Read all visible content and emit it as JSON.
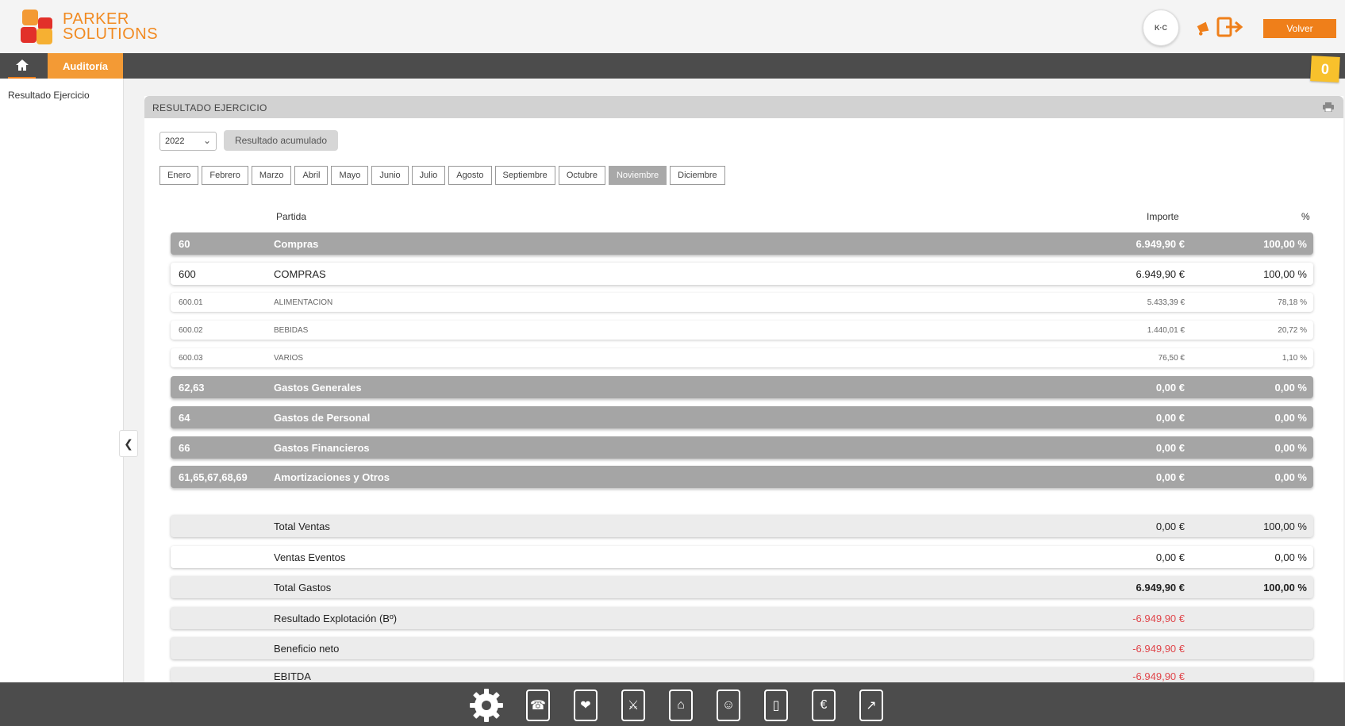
{
  "header": {
    "brand_line1": "PARKER",
    "brand_line2": "SOLUTIONS",
    "avatar_text": "K·C",
    "back_button": "Volver",
    "notifications_count": "0"
  },
  "nav": {
    "active_tab": "Auditoría"
  },
  "sidebar": {
    "items": [
      {
        "label": "Resultado Ejercicio"
      }
    ]
  },
  "panel": {
    "title": "RESULTADO EJERCICIO",
    "year": "2022",
    "acumulado_button": "Resultado acumulado",
    "months": [
      "Enero",
      "Febrero",
      "Marzo",
      "Abril",
      "Mayo",
      "Junio",
      "Julio",
      "Agosto",
      "Septiembre",
      "Octubre",
      "Noviembre",
      "Diciembre"
    ],
    "selected_month": "Noviembre",
    "columns": {
      "partida": "Partida",
      "importe": "Importe",
      "pct": "%"
    }
  },
  "rows": [
    {
      "type": "group",
      "code": "60",
      "name": "Compras",
      "amount": "6.949,90 €",
      "pct": "100,00 %"
    },
    {
      "type": "account",
      "code": "600",
      "name": "COMPRAS",
      "amount": "6.949,90 €",
      "pct": "100,00 %"
    },
    {
      "type": "sub",
      "code": "600.01",
      "name": "ALIMENTACION",
      "amount": "5.433,39 €",
      "pct": "78,18 %"
    },
    {
      "type": "sub",
      "code": "600.02",
      "name": "BEBIDAS",
      "amount": "1.440,01 €",
      "pct": "20,72 %"
    },
    {
      "type": "sub",
      "code": "600.03",
      "name": "VARIOS",
      "amount": "76,50 €",
      "pct": "1,10 %"
    },
    {
      "type": "group",
      "code": "62,63",
      "name": "Gastos Generales",
      "amount": "0,00 €",
      "pct": "0,00 %"
    },
    {
      "type": "group",
      "code": "64",
      "name": "Gastos de Personal",
      "amount": "0,00 €",
      "pct": "0,00 %"
    },
    {
      "type": "group",
      "code": "66",
      "name": "Gastos Financieros",
      "amount": "0,00 €",
      "pct": "0,00 %"
    },
    {
      "type": "group",
      "code": "61,65,67,68,69",
      "name": "Amortizaciones y Otros",
      "amount": "0,00 €",
      "pct": "0,00 %"
    }
  ],
  "summary": [
    {
      "type": "total",
      "name": "Total Ventas",
      "amount": "0,00 €",
      "pct": "100,00 %",
      "bold": false
    },
    {
      "type": "plain",
      "name": "Ventas Eventos",
      "amount": "0,00 €",
      "pct": "0,00 %",
      "bold": false
    },
    {
      "type": "total",
      "name": "Total Gastos",
      "amount": "6.949,90 €",
      "pct": "100,00 %",
      "bold": true
    },
    {
      "type": "total",
      "name": "Resultado Explotación (Bº)",
      "amount": "-6.949,90 €",
      "pct": "",
      "negative": true
    },
    {
      "type": "total",
      "name": "Beneficio neto",
      "amount": "-6.949,90 €",
      "pct": "",
      "negative": true
    },
    {
      "type": "total",
      "name": "EBITDA",
      "amount": "-6.949,90 €",
      "pct": "",
      "negative": true
    }
  ],
  "dock": {
    "icons": [
      "headset-icon",
      "handshake-icon",
      "cutlery-icon",
      "cart-icon",
      "contacts-icon",
      "mobile-icon",
      "euro-icon",
      "chart-icon"
    ]
  },
  "colors": {
    "accent": "#ef7f1a",
    "group_row": "#a5a5a5",
    "negative": "#e0454a"
  }
}
